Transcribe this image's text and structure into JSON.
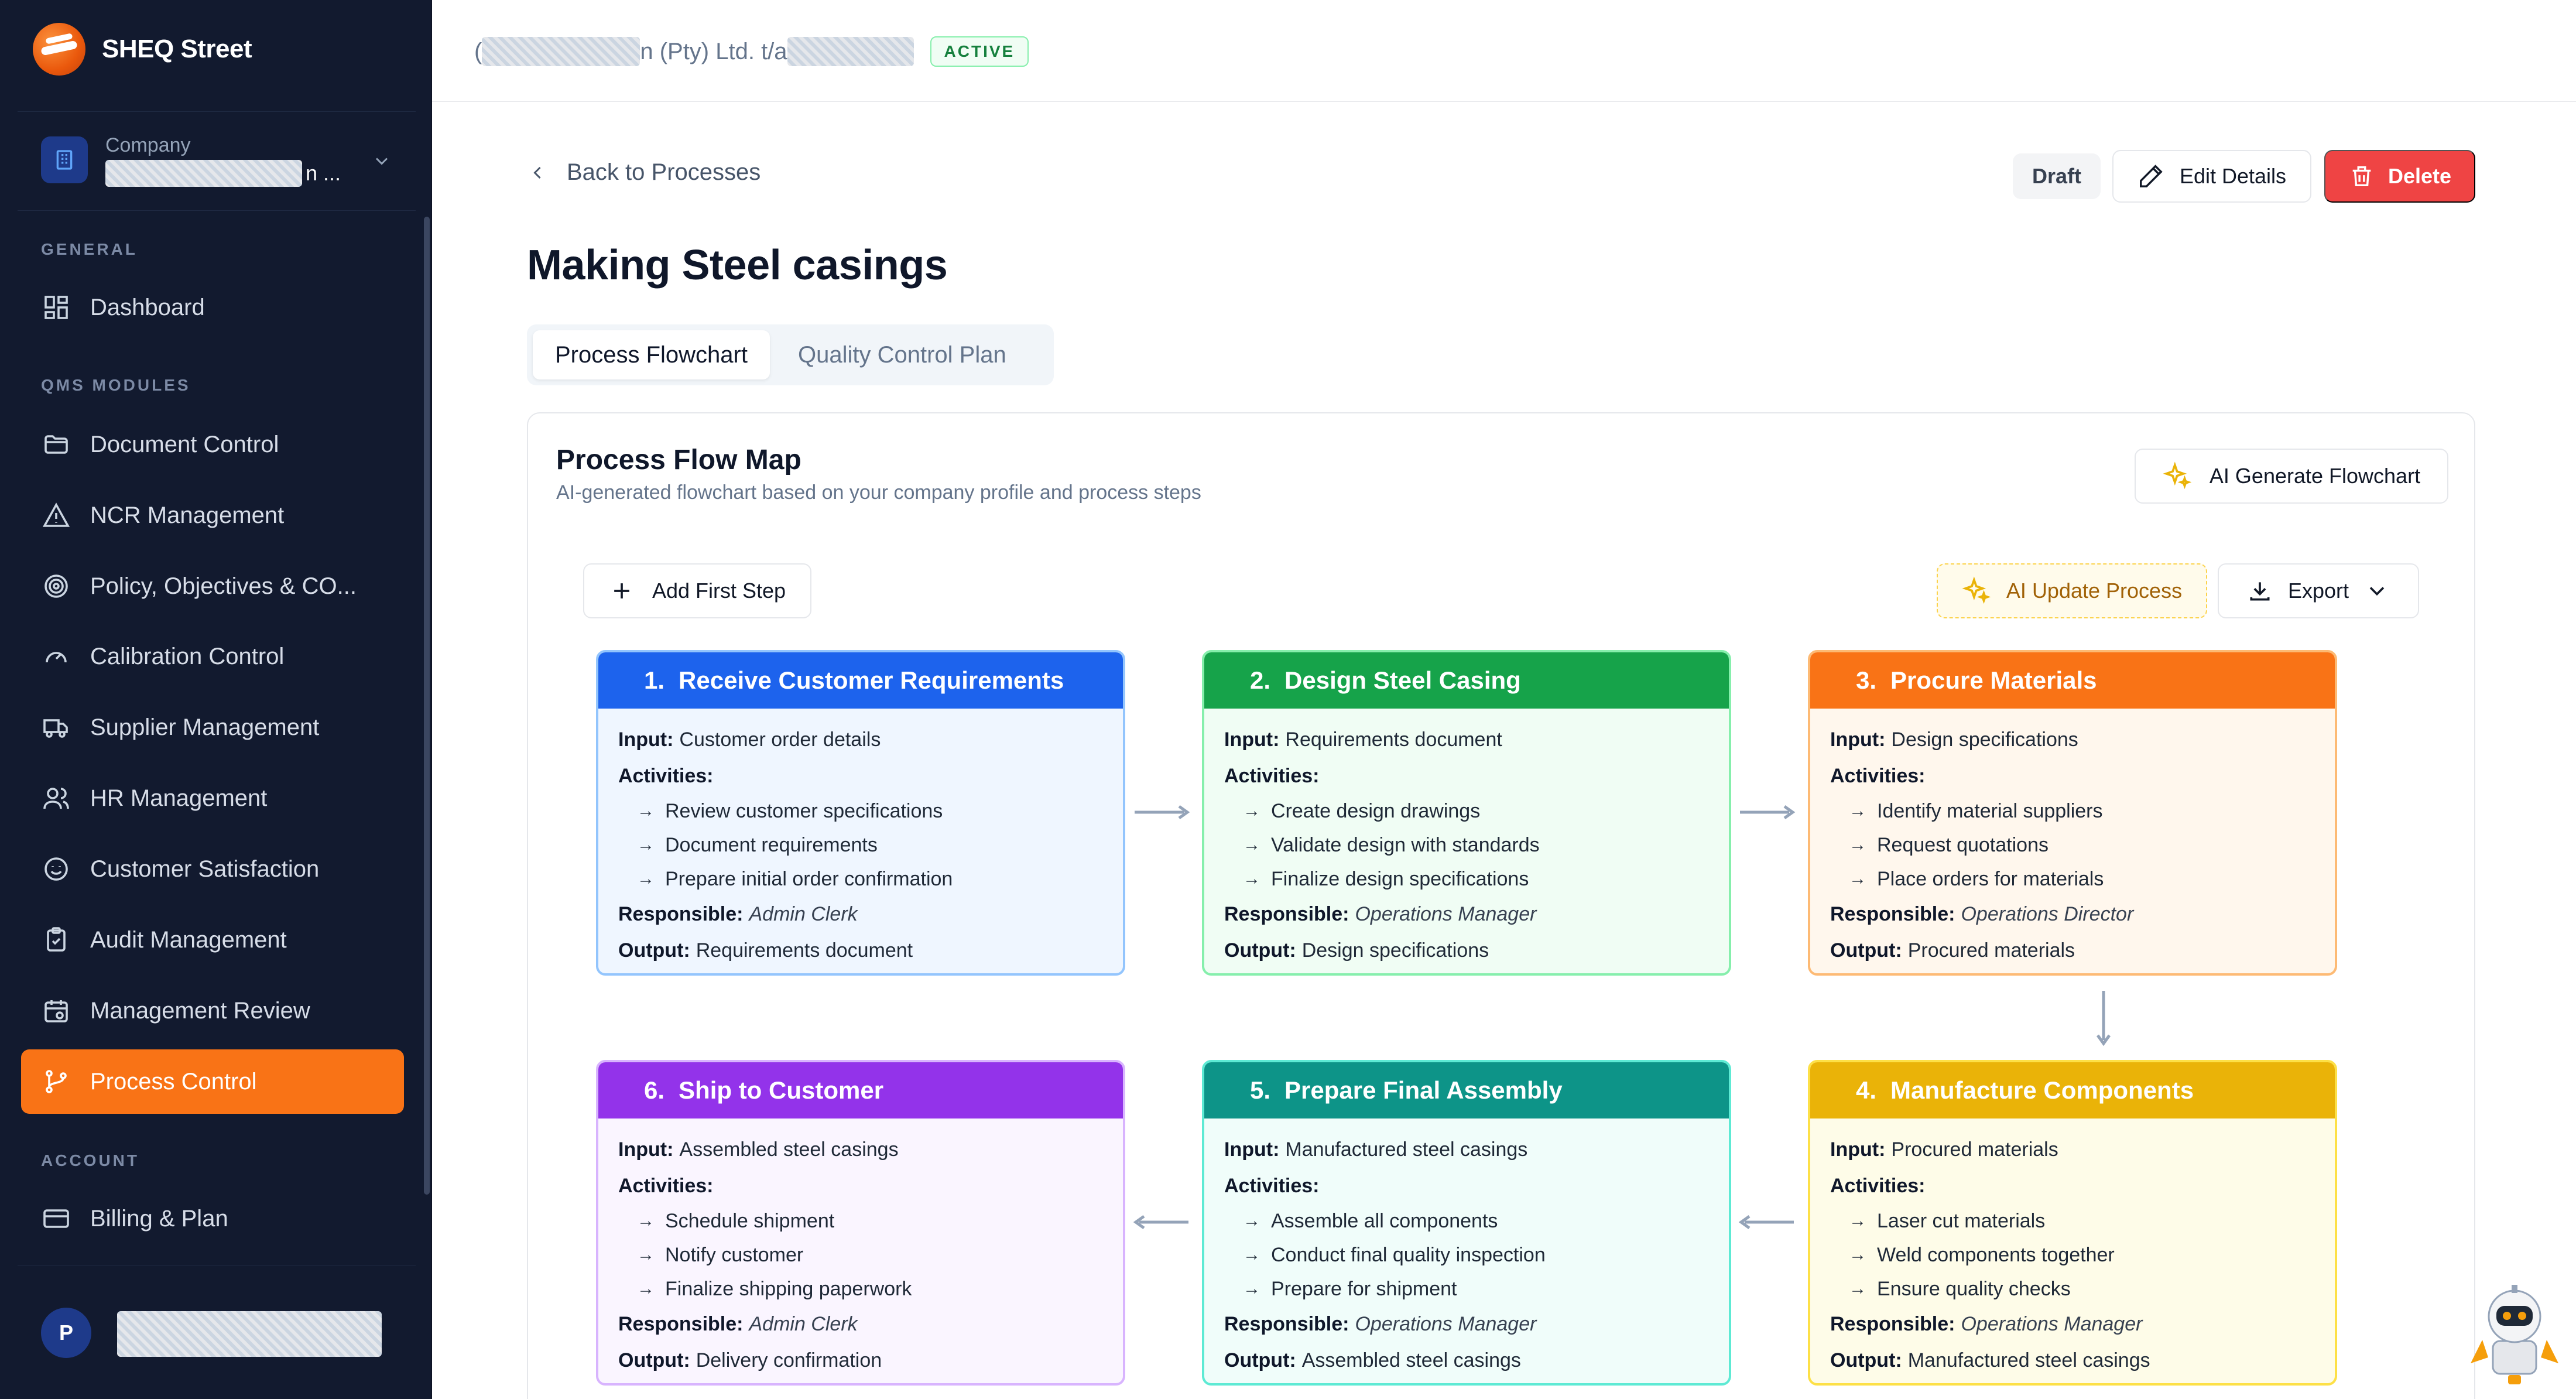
{
  "brand": {
    "name": "SHEQ Street"
  },
  "company": {
    "label": "Company",
    "name_tail": "n ..."
  },
  "sidebar": {
    "sections": {
      "general": "GENERAL",
      "qms": "QMS MODULES",
      "account": "ACCOUNT"
    },
    "items": [
      {
        "label": "Dashboard",
        "icon": "dashboard-icon"
      },
      {
        "label": "Document Control",
        "icon": "folder-icon"
      },
      {
        "label": "NCR Management",
        "icon": "warning-icon"
      },
      {
        "label": "Policy, Objectives & CO...",
        "icon": "target-icon"
      },
      {
        "label": "Calibration Control",
        "icon": "gauge-icon"
      },
      {
        "label": "Supplier Management",
        "icon": "truck-icon"
      },
      {
        "label": "HR Management",
        "icon": "users-icon"
      },
      {
        "label": "Customer Satisfaction",
        "icon": "smile-icon"
      },
      {
        "label": "Audit Management",
        "icon": "clipboard-icon"
      },
      {
        "label": "Management Review",
        "icon": "calendar-icon"
      },
      {
        "label": "Process Control",
        "icon": "process-icon"
      },
      {
        "label": "Billing & Plan",
        "icon": "card-icon"
      }
    ],
    "user_initial": "P"
  },
  "topbar": {
    "org_prefix": "(",
    "org_mid": "n (Pty) Ltd. t/a",
    "status": "ACTIVE"
  },
  "page": {
    "back_label": "Back to Processes",
    "title": "Making Steel casings",
    "draft_label": "Draft",
    "edit_label": "Edit Details",
    "delete_label": "Delete",
    "tabs": [
      "Process Flowchart",
      "Quality Control Plan"
    ]
  },
  "flowmap": {
    "title": "Process Flow Map",
    "subtitle": "AI-generated flowchart based on your company profile and process steps",
    "ai_generate_label": "AI Generate Flowchart",
    "add_step_label": "Add First Step",
    "ai_update_label": "AI Update Process",
    "export_label": "Export",
    "labels": {
      "input": "Input:",
      "activities": "Activities:",
      "responsible": "Responsible:",
      "output": "Output:"
    },
    "steps": [
      {
        "num": "1.",
        "title": "Receive Customer Requirements",
        "color": "#1d63ed",
        "border": "#93c5fd",
        "bg": "#eff6ff",
        "input": "Customer order details",
        "activities": [
          "Review customer specifications",
          "Document requirements",
          "Prepare initial order confirmation"
        ],
        "responsible": "Admin Clerk",
        "output": "Requirements document"
      },
      {
        "num": "2.",
        "title": "Design Steel Casing",
        "color": "#16a34a",
        "border": "#86efac",
        "bg": "#f0fdf4",
        "input": "Requirements document",
        "activities": [
          "Create design drawings",
          "Validate design with standards",
          "Finalize design specifications"
        ],
        "responsible": "Operations Manager",
        "output": "Design specifications"
      },
      {
        "num": "3.",
        "title": "Procure Materials",
        "color": "#f97316",
        "border": "#fdba74",
        "bg": "#fff7ed",
        "input": "Design specifications",
        "activities": [
          "Identify material suppliers",
          "Request quotations",
          "Place orders for materials"
        ],
        "responsible": "Operations Director",
        "output": "Procured materials"
      },
      {
        "num": "4.",
        "title": "Manufacture Components",
        "color": "#eab308",
        "border": "#fde047",
        "bg": "#fefce8",
        "input": "Procured materials",
        "activities": [
          "Laser cut materials",
          "Weld components together",
          "Ensure quality checks"
        ],
        "responsible": "Operations Manager",
        "output": "Manufactured steel casings"
      },
      {
        "num": "5.",
        "title": "Prepare Final Assembly",
        "color": "#0d9488",
        "border": "#5eead4",
        "bg": "#f0fdfa",
        "input": "Manufactured steel casings",
        "activities": [
          "Assemble all components",
          "Conduct final quality inspection",
          "Prepare for shipment"
        ],
        "responsible": "Operations Manager",
        "output": "Assembled steel casings"
      },
      {
        "num": "6.",
        "title": "Ship to Customer",
        "color": "#9333ea",
        "border": "#d8b4fe",
        "bg": "#faf5ff",
        "input": "Assembled steel casings",
        "activities": [
          "Schedule shipment",
          "Notify customer",
          "Finalize shipping paperwork"
        ],
        "responsible": "Admin Clerk",
        "output": "Delivery confirmation"
      }
    ]
  }
}
